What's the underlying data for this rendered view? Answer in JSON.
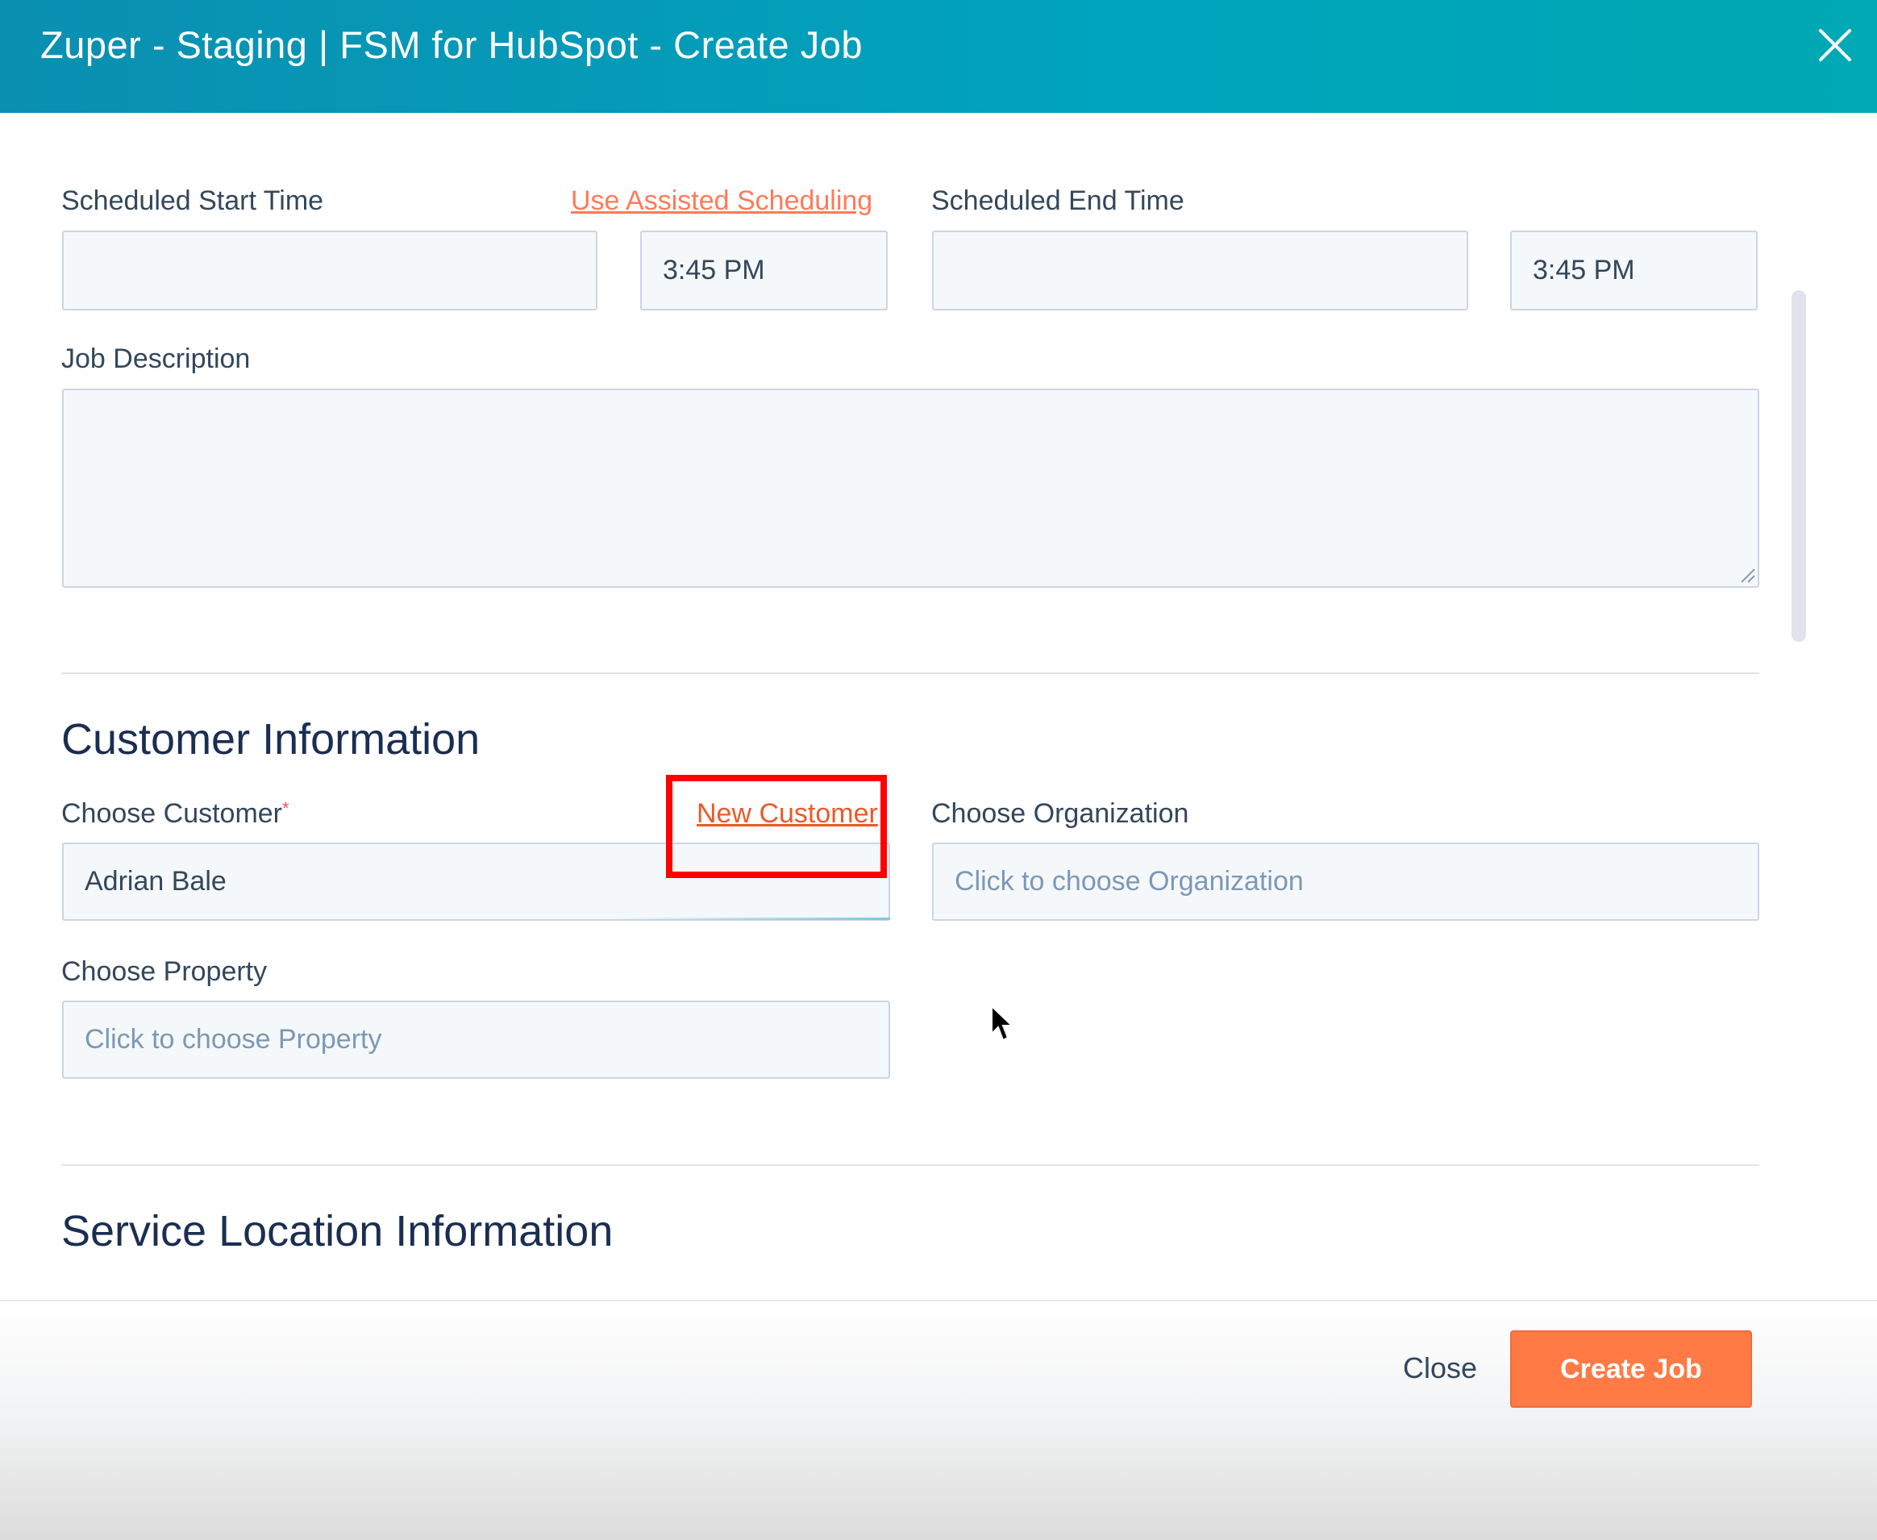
{
  "header": {
    "title": "Zuper - Staging | FSM for HubSpot - Create Job"
  },
  "schedule": {
    "start_label": "Scheduled Start Time",
    "assisted_link": "Use Assisted Scheduling",
    "start_date_value": "",
    "start_time_value": "3:45 PM",
    "end_label": "Scheduled End Time",
    "end_date_value": "",
    "end_time_value": "3:45 PM"
  },
  "description": {
    "label": "Job Description",
    "value": ""
  },
  "customer_section": {
    "title": "Customer Information",
    "customer_label": "Choose Customer",
    "required_mark": "*",
    "new_customer_link": "New Customer",
    "customer_value": "Adrian Bale",
    "organization_label": "Choose Organization",
    "organization_placeholder": "Click to choose Organization",
    "property_label": "Choose Property",
    "property_placeholder": "Click to choose Property"
  },
  "service_section": {
    "title": "Service Location Information"
  },
  "footer": {
    "close_label": "Close",
    "create_label": "Create Job"
  },
  "colors": {
    "header_gradient": [
      "#0b8fb1",
      "#00a9b3"
    ],
    "accent_orange": "#ff7a45",
    "link_orange": "#ff7a59",
    "highlight_red": "#ff0000"
  },
  "icons": [
    "close-icon",
    "resize-grip-icon",
    "mouse-cursor-icon"
  ]
}
